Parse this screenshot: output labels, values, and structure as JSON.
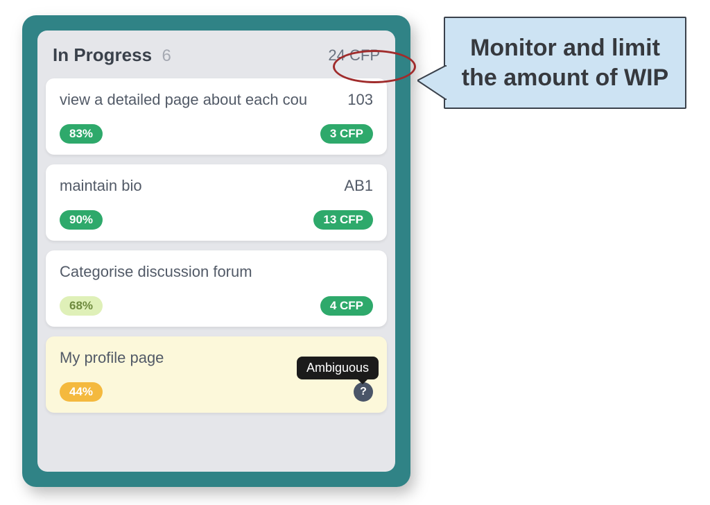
{
  "column": {
    "title": "In Progress",
    "count": "6",
    "cfp": "24 CFP"
  },
  "cards": [
    {
      "title": "view a detailed page about each cou",
      "id": "103",
      "pct": "83%",
      "pct_style": "pct-green",
      "cfp": "3 CFP",
      "highlight": false,
      "help": false
    },
    {
      "title": "maintain bio",
      "id": "AB1",
      "pct": "90%",
      "pct_style": "pct-green",
      "cfp": "13 CFP",
      "highlight": false,
      "help": false
    },
    {
      "title": "Categorise discussion forum",
      "id": "",
      "pct": "68%",
      "pct_style": "pct-lime",
      "cfp": "4 CFP",
      "highlight": false,
      "help": false
    },
    {
      "title": "My profile page",
      "id": "",
      "pct": "44%",
      "pct_style": "pct-amber",
      "cfp": "",
      "highlight": true,
      "help": true
    }
  ],
  "tooltip": "Ambiguous",
  "help_glyph": "?",
  "callout": "Monitor and limit the amount of WIP"
}
